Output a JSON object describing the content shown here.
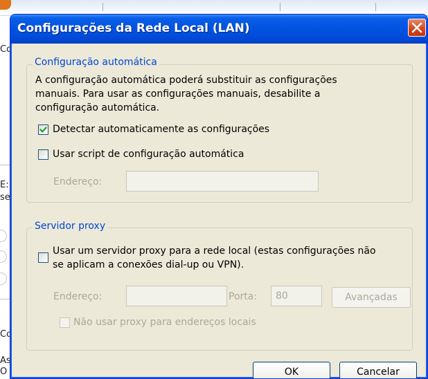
{
  "background_window": {
    "left_fragments": [
      "Co",
      "E:",
      "se",
      "Co",
      "As",
      "O"
    ]
  },
  "dialog": {
    "title": "Configurações da Rede Local (LAN)",
    "close_icon": "close-x-icon",
    "auto_config": {
      "legend": "Configuração automática",
      "description_lines": [
        "A configuração automática poderá substituir as configurações",
        "manuais. Para usar as configurações manuais, desabilite a",
        "configuração automática."
      ],
      "detect_checkbox": {
        "label": "Detectar automaticamente as configurações",
        "checked": true
      },
      "script_checkbox": {
        "label": "Usar script de configuração automática",
        "checked": false
      },
      "address_label": "Endereço:",
      "address_value": ""
    },
    "proxy": {
      "legend": "Servidor proxy",
      "use_proxy_checkbox": {
        "label_lines": [
          "Usar um servidor proxy para a rede local (estas configurações não",
          "se aplicam a conexões dial-up ou VPN)."
        ],
        "checked": false
      },
      "address_label": "Endereço:",
      "address_value": "",
      "port_label": "Porta:",
      "port_value": "80",
      "advanced_button": "Avançadas",
      "bypass_checkbox": {
        "label": "Não usar proxy para endereços locais",
        "checked": false
      }
    },
    "ok_button": "OK",
    "cancel_button": "Cancelar"
  },
  "colors": {
    "title_bar": "#0053e1",
    "dialog_face": "#ece9d8",
    "legend_text": "#0046d5",
    "check_mark": "#21a121",
    "disabled_text": "#aca899"
  }
}
